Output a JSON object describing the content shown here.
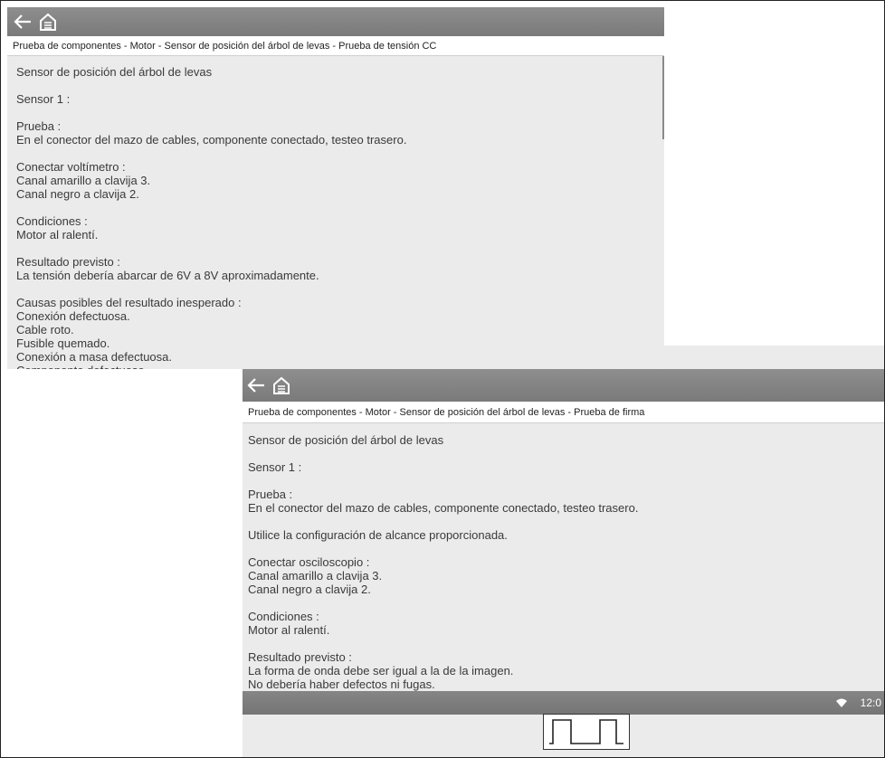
{
  "screen1": {
    "breadcrumb": "Prueba de componentes - Motor - Sensor de posición del árbol de levas - Prueba de tensión CC",
    "blocks": [
      [
        "Sensor de posición del árbol de levas"
      ],
      [
        "Sensor 1 :"
      ],
      [
        "Prueba :",
        "En el conector del mazo de cables, componente conectado, testeo trasero."
      ],
      [
        "Conectar voltímetro :",
        "Canal amarillo a clavija 3.",
        "Canal negro a clavija 2."
      ],
      [
        "Condiciones :",
        "Motor al ralentí."
      ],
      [
        "Resultado previsto :",
        "La tensión debería abarcar de 6V a 8V aproximadamente."
      ],
      [
        "Causas posibles del resultado inesperado :",
        "Conexión defectuosa.",
        "Cable roto.",
        "Fusible quemado.",
        "Conexión a masa defectuosa.",
        "Componente defectuoso."
      ]
    ]
  },
  "screen2": {
    "status_time": "12:0",
    "breadcrumb": "Prueba de componentes - Motor - Sensor de posición del árbol de levas - Prueba de firma",
    "blocks": [
      [
        "Sensor de posición del árbol de levas"
      ],
      [
        "Sensor 1 :"
      ],
      [
        "Prueba :",
        "En el conector del mazo de cables, componente conectado, testeo trasero."
      ],
      [
        "Utilice la configuración de alcance proporcionada."
      ],
      [
        "Conectar osciloscopio :",
        "Canal amarillo a clavija 3.",
        "Canal negro a clavija 2."
      ],
      [
        "Condiciones :",
        "Motor al ralentí."
      ],
      [
        "Resultado previsto :",
        "La forma de onda debe ser igual a la de la imagen.",
        "No debería haber defectos ni fugas."
      ]
    ]
  },
  "icons": {
    "back": "back-arrow-icon",
    "home": "home-icon",
    "wifi": "wifi-icon"
  },
  "colors": {
    "toolbar": "#858585",
    "background": "#ebebeb"
  }
}
